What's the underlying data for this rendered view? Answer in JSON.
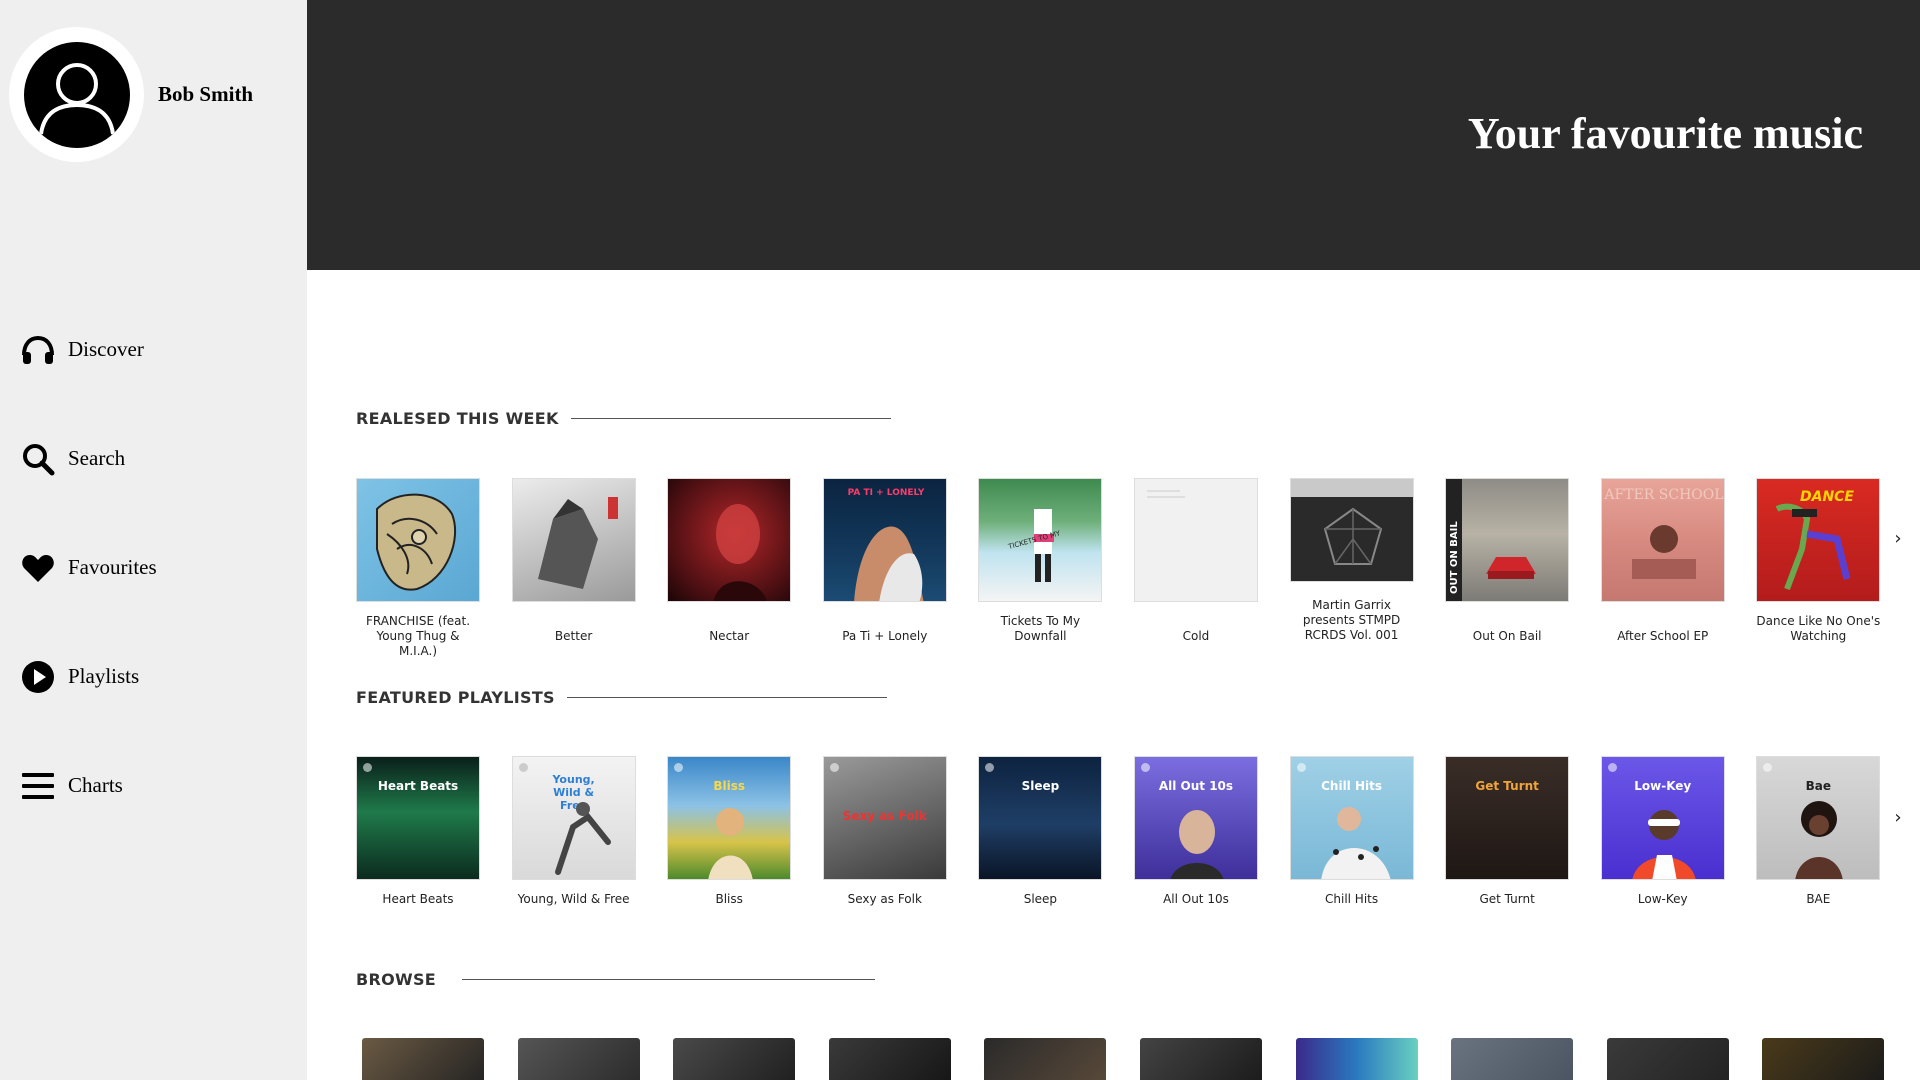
{
  "profile": {
    "name": "Bob Smith"
  },
  "nav": [
    {
      "label": "Discover",
      "icon": "headphones-icon"
    },
    {
      "label": "Search",
      "icon": "search-icon"
    },
    {
      "label": "Favourites",
      "icon": "heart-icon"
    },
    {
      "label": "Playlists",
      "icon": "play-circle-icon"
    },
    {
      "label": "Charts",
      "icon": "menu-bars-icon"
    }
  ],
  "hero": {
    "title": "Your favourite music"
  },
  "released": {
    "title": "REALESED THIS WEEK",
    "items": [
      {
        "title": "FRANCHISE (feat. Young Thug & M.I.A.)"
      },
      {
        "title": "Better"
      },
      {
        "title": "Nectar"
      },
      {
        "title": "Pa Ti + Lonely"
      },
      {
        "title": "Tickets To My Downfall"
      },
      {
        "title": "Cold"
      },
      {
        "title": "Martin Garrix presents STMPD RCRDS Vol. 001"
      },
      {
        "title": "Out On Bail"
      },
      {
        "title": "After School EP"
      },
      {
        "title": "Dance Like No One's Watching"
      }
    ]
  },
  "featured": {
    "title": "FEATURED PLAYLISTS",
    "items": [
      {
        "title": "Heart Beats",
        "cover_text": "Heart Beats"
      },
      {
        "title": "Young, Wild & Free",
        "cover_text": "Young, Wild & Free"
      },
      {
        "title": "Bliss",
        "cover_text": "Bliss"
      },
      {
        "title": "Sexy as Folk",
        "cover_text": "Sexy as Folk"
      },
      {
        "title": "Sleep",
        "cover_text": "Sleep"
      },
      {
        "title": "All Out 10s",
        "cover_text": "All Out 10s"
      },
      {
        "title": "Chill Hits",
        "cover_text": "Chill Hits"
      },
      {
        "title": "Get Turnt",
        "cover_text": "Get Turnt"
      },
      {
        "title": "Low-Key",
        "cover_text": "Low-Key"
      },
      {
        "title": "BAE",
        "cover_text": "Bae"
      }
    ]
  },
  "browse": {
    "title": "BROWSE"
  },
  "arrows": {
    "next": "›"
  },
  "colors": {
    "sidebar": "#efefef",
    "hero": "#2b2b2b"
  }
}
